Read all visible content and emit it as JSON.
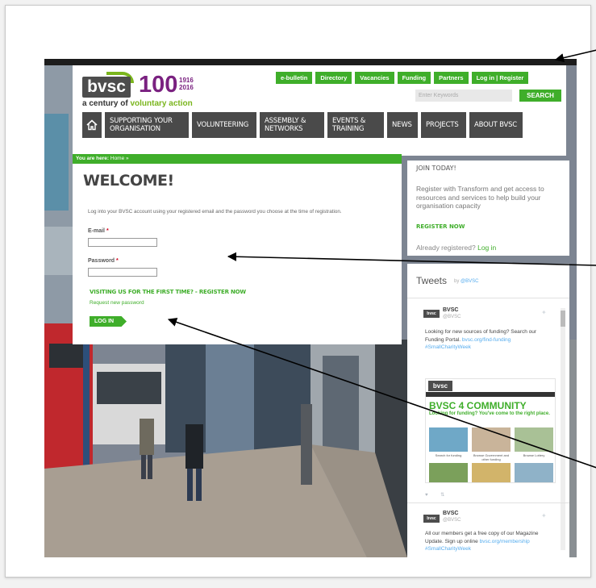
{
  "logo": {
    "brand": "bvsc",
    "hundred": "100",
    "year_start": "1916",
    "year_end": "2016",
    "tagline_prefix": "a century of",
    "tagline_highlight": "voluntary action"
  },
  "top_links": [
    "e-bulletin",
    "Directory",
    "Vacancies",
    "Funding",
    "Partners",
    "Log in | Register"
  ],
  "search": {
    "placeholder": "Enter Keywords",
    "button": "SEARCH"
  },
  "nav": {
    "home_icon": "home-icon",
    "items": [
      "SUPPORTING YOUR ORGANISATION",
      "VOLUNTEERING",
      "ASSEMBLY & NETWORKS",
      "EVENTS & TRAINING",
      "NEWS",
      "PROJECTS",
      "ABOUT BVSC"
    ]
  },
  "breadcrumb": {
    "prefix": "You are here:",
    "home": "Home",
    "separator": "»"
  },
  "welcome": {
    "title": "WELCOME!",
    "intro": "Log into your BVSC account using your registered email and the password you choose at the time of registration.",
    "email_label": "E-mail",
    "password_label": "Password",
    "required_mark": "*",
    "first_time": "VISITING US FOR THE FIRST TIME? - REGISTER NOW",
    "forgot": "Request new password",
    "login_button": "LOG IN"
  },
  "join": {
    "title": "JOIN TODAY!",
    "text": "Register with Transform and get access to resources and services to help build your organisation capacity",
    "register": "REGISTER NOW",
    "already": "Already registered?",
    "login": "Log in"
  },
  "tweets": {
    "heading": "Tweets",
    "by": "by",
    "handle": "@BVSC",
    "items": [
      {
        "name": "BVSC",
        "handle": "@BVSC",
        "text": "Looking for new sources of funding? Search our Funding Portal.",
        "link": "bvsc.org/find-funding",
        "hashtag": "#SmallCharityWeek"
      },
      {
        "name": "BVSC",
        "handle": "@BVSC",
        "text": "All our members get a free copy of our Magazine Update. Sign up online",
        "link": "bvsc.org/membership",
        "hashtag": "#SmallCharityWeek"
      }
    ],
    "image": {
      "logo": "bvsc",
      "title": "BVSC 4 COMMUNITY",
      "subtitle": "Looking for funding? You've come to the right place.",
      "captions": [
        "Search for funding",
        "Browse Government and other funding",
        "Browse Lottery"
      ]
    }
  },
  "colors": {
    "green": "#3fae2a",
    "purple": "#7a2180",
    "nav_grey": "#4a4a4a",
    "arrow": "#000000"
  }
}
